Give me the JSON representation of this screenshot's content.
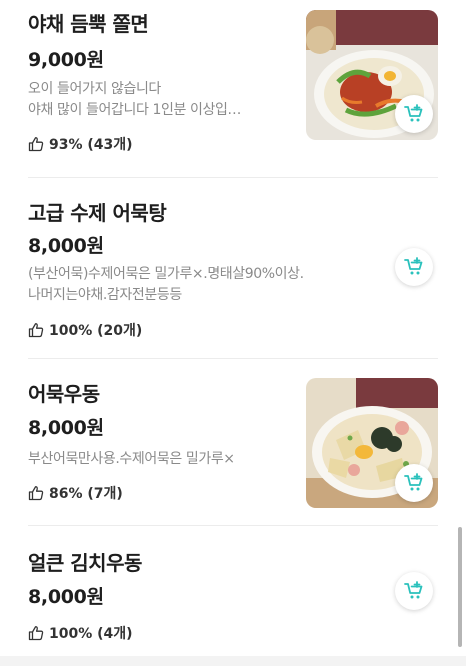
{
  "items": [
    {
      "name": "야채 듬뿍 쫄면",
      "price": "9,000원",
      "desc_lines": [
        "오이 들어가지 않습니다",
        "야채 많이 들어갑니다 1인분 이상입…"
      ],
      "rating": "93% (43개)",
      "has_photo": true,
      "photo_icon": "jjolmyeon-photo"
    },
    {
      "name": "고급 수제 어묵탕",
      "price": "8,000원",
      "desc_lines": [
        "(부산어묵)수제어묵은 밀가루×.명태살90%이상.",
        "나머지는야채.감자전분등등"
      ],
      "rating": "100% (20개)",
      "has_photo": false
    },
    {
      "name": "어묵우동",
      "price": "8,000원",
      "desc_lines": [
        "부산어묵만사용.수제어묵은 밀가루×"
      ],
      "rating": "86% (7개)",
      "has_photo": true,
      "photo_icon": "eomuk-udon-photo"
    },
    {
      "name": "얼큰 김치우동",
      "price": "8,000원",
      "desc_lines": [],
      "rating": "100% (4개)",
      "has_photo": false
    }
  ],
  "icons": {
    "rating": "thumbs-up-icon",
    "cart": "add-to-cart-icon"
  },
  "colors": {
    "accent": "#2ac1bc",
    "text_primary": "#1e1e1e",
    "text_secondary": "#8a8a8a"
  }
}
